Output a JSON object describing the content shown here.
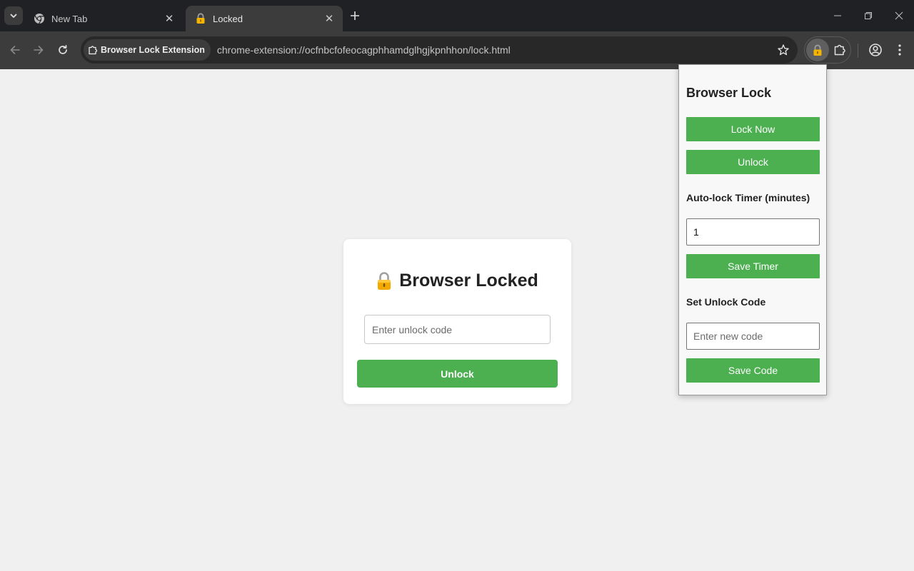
{
  "browser": {
    "tabs": [
      {
        "title": "New Tab",
        "icon": "chrome-icon",
        "active": false
      },
      {
        "title": "Locked",
        "icon": "lock-icon",
        "active": true
      }
    ],
    "site_chip": "Browser Lock Extension",
    "url": "chrome-extension://ocfnbcfofeocagphhamdglhgjkpnhhon/lock.html",
    "colors": {
      "tabstrip": "#202124",
      "toolbar": "#3c3c3c",
      "omnibox": "#282828"
    }
  },
  "lock_page": {
    "title_emoji": "🔒",
    "title": "Browser Locked",
    "input_placeholder": "Enter unlock code",
    "unlock_label": "Unlock",
    "accent": "#4caf50"
  },
  "popup": {
    "title": "Browser Lock",
    "lock_now_label": "Lock Now",
    "unlock_label": "Unlock",
    "timer_label": "Auto-lock Timer (minutes)",
    "timer_value": "1",
    "save_timer_label": "Save Timer",
    "code_label": "Set Unlock Code",
    "code_placeholder": "Enter new code",
    "save_code_label": "Save Code",
    "accent": "#4caf50"
  }
}
